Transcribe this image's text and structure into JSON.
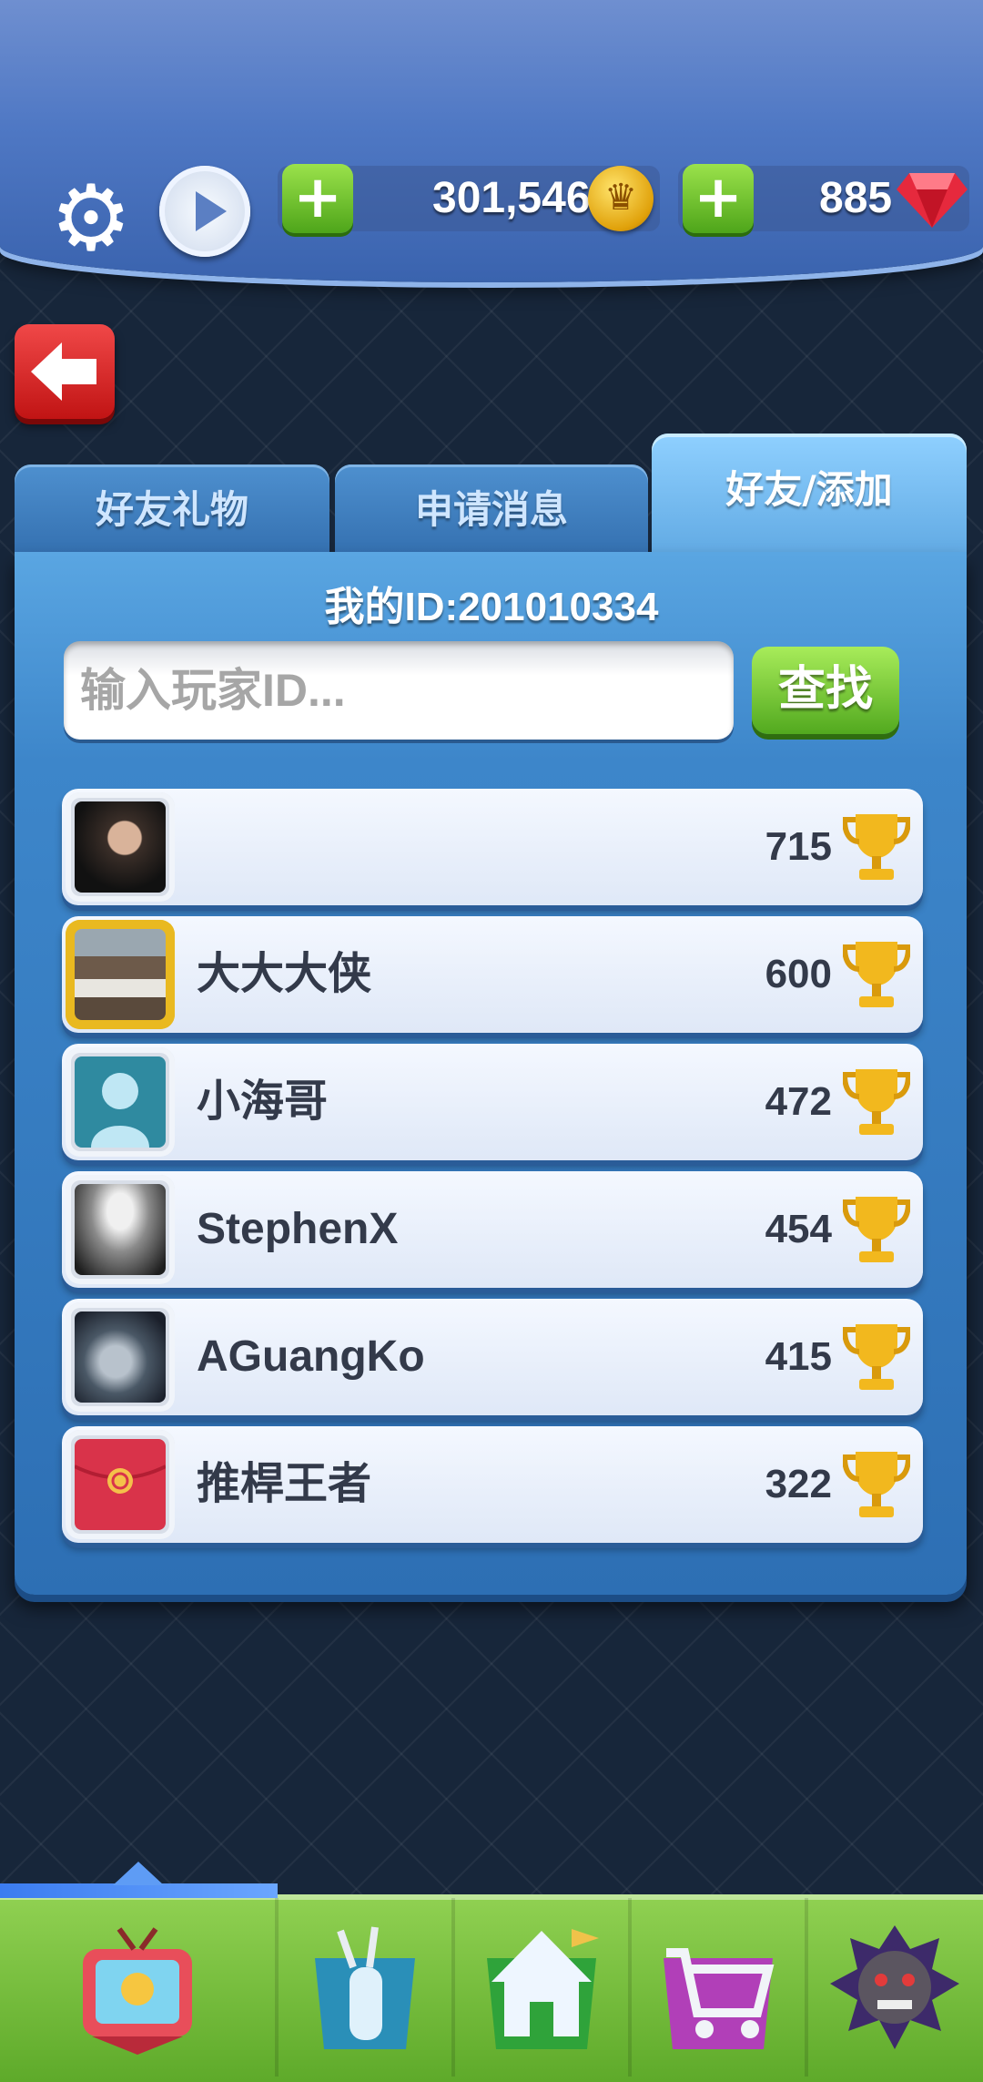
{
  "header": {
    "coins": "301,546",
    "gems": "885"
  },
  "tabs": [
    {
      "label": "好友礼物"
    },
    {
      "label": "申请消息"
    },
    {
      "label": "好友/添加"
    }
  ],
  "panel": {
    "my_id": "我的ID:201010334",
    "search_placeholder": "输入玩家ID...",
    "search_button": "查找"
  },
  "friends": [
    {
      "name": "",
      "score": "715"
    },
    {
      "name": "大大大侠",
      "score": "600"
    },
    {
      "name": "小海哥",
      "score": "472"
    },
    {
      "name": "StephenX",
      "score": "454"
    },
    {
      "name": "AGuangKo",
      "score": "415"
    },
    {
      "name": "推桿王者",
      "score": "322"
    }
  ],
  "colors": {
    "accent_green": "#5eaa2a",
    "panel_blue": "#3d86ca",
    "back_red": "#c11414"
  },
  "icons": [
    "gear-icon",
    "play-icon",
    "plus-icon",
    "crown-coin-icon",
    "gem-icon",
    "back-arrow-icon",
    "trophy-icon",
    "tv-icon",
    "golf-bag-icon",
    "home-icon",
    "cart-icon",
    "bulldog-icon"
  ]
}
